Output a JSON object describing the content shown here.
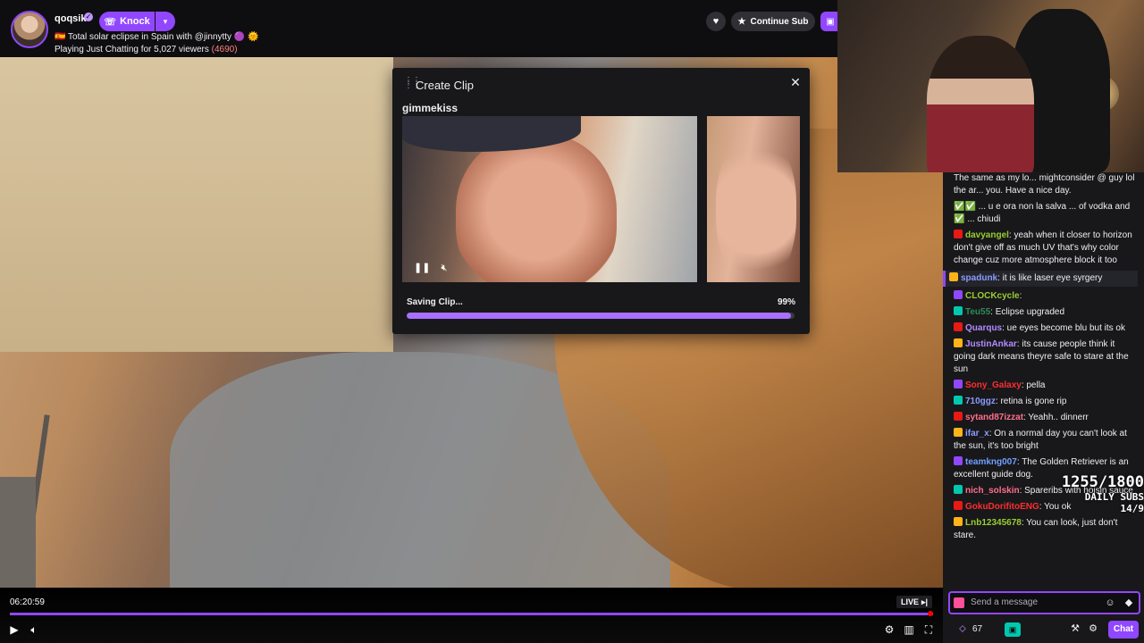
{
  "channel": {
    "name": "qoqsik",
    "knock_label": "Knock",
    "title": "🇪🇸 Total solar eclipse in Spain with @jinnytty 🟣 🌞",
    "playing_prefix": "Playing Just Chatting for 5,027 viewers ",
    "viewers_extra": "(4690)",
    "continue_sub_label": "Continue Sub"
  },
  "player": {
    "time": "06:20:59",
    "live_label": "LIVE",
    "progress_fraction": 0.995
  },
  "clip_modal": {
    "title": "Create Clip",
    "clip_user": "gimmekiss",
    "saving_label": "Saving Clip...",
    "saving_percent": "99%",
    "progress_fraction": 0.99
  },
  "chat": {
    "messages": [
      {
        "user": "",
        "text": "The same as my lo... mightconsider @ guy lol the ar... you. Have a nice day.",
        "color": "#efeff1"
      },
      {
        "user": "",
        "text": "✅✅ ... u e ora non la salva ... of vodka and ✅ ... chiudi",
        "color": "#efeff1"
      },
      {
        "user": "davyangel",
        "text": ": yeah when it closer to horizon don't give off as much UV that's why color change cuz more atmosphere block it too",
        "color": "#9acd32"
      },
      {
        "user": "spadunk",
        "text": ": it is like laser eye syrgery",
        "color": "#8a9cff",
        "first": true
      },
      {
        "user": "CLOCKcycle",
        "text": ":",
        "color": "#9acd32"
      },
      {
        "user": "Teu55",
        "text": ": Eclipse upgraded",
        "color": "#2e8b57"
      },
      {
        "user": "Quarqus",
        "text": ": ue eyes become blu but its ok",
        "color": "#b08cff"
      },
      {
        "user": "JustinAnkar",
        "text": ": its cause people think it going dark means theyre safe to stare at the sun",
        "color": "#b08cff"
      },
      {
        "user": "Sony_Galaxy",
        "text": ": pella",
        "color": "#ff2e2e"
      },
      {
        "user": "710ggz",
        "text": ": retina is gone rip",
        "color": "#8a9cff"
      },
      {
        "user": "sytand87izzat",
        "text": ": Yeahh.. dinnerr",
        "color": "#ff6f8a"
      },
      {
        "user": "ifar_x",
        "text": ": On a normal day you can't look at the sun, it's too bright",
        "color": "#8a9cff"
      },
      {
        "user": "teamkng007",
        "text": ": The Golden Retriever is an excellent guide dog.",
        "color": "#6fa0ff"
      },
      {
        "user": "nich_solskin",
        "text": ": Spareribs with hoisin sauce",
        "color": "#ff6f8a"
      },
      {
        "user": "GokuDorifitoENG",
        "text": ": You ok",
        "color": "#ff2e2e"
      },
      {
        "user": "Lnb12345678",
        "text": ": You can look, just don't stare.",
        "color": "#9acd32"
      }
    ],
    "overlay_counter": "1255/1800",
    "overlay_daily": "DAILY SUBS 14/9",
    "input_placeholder": "Send a message",
    "points_count": "67",
    "chat_button_label": "Chat"
  },
  "icons": {
    "gift": "gift-icon",
    "heart": "heart-icon",
    "star": "star-icon",
    "close": "close-icon",
    "settings": "gear-icon"
  },
  "colors": {
    "accent": "#9147ff",
    "background": "#18181b"
  }
}
